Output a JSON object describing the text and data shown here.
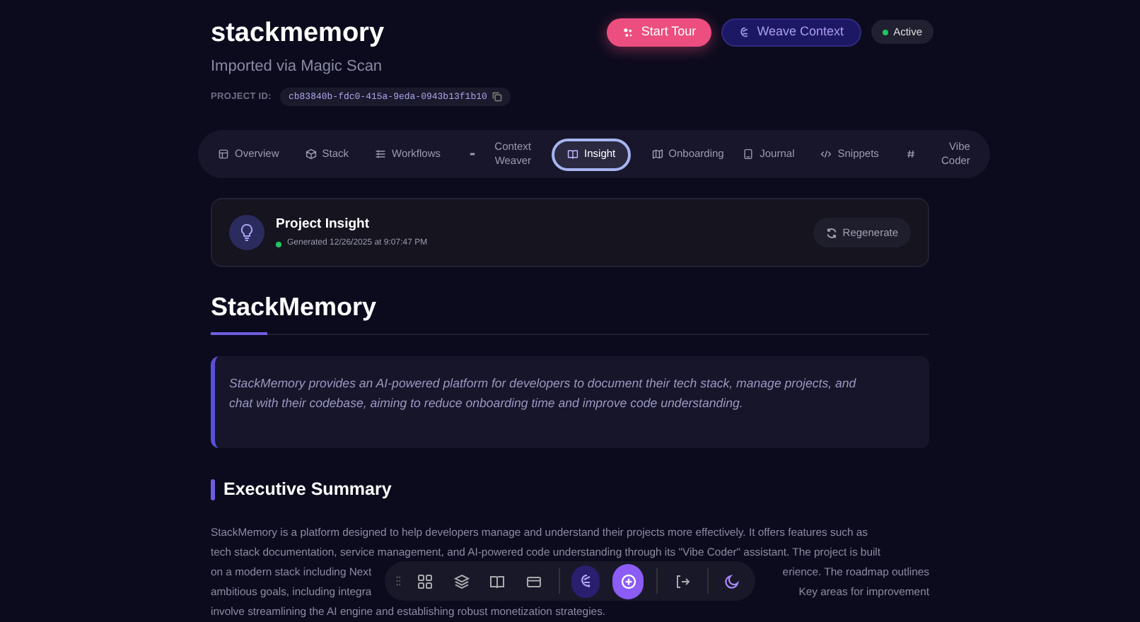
{
  "header": {
    "title": "stackmemory",
    "subtitle": "Imported via Magic Scan",
    "project_id_label": "PROJECT ID:",
    "project_id": "cb83840b-fdc0-415a-9eda-0943b13f1b10"
  },
  "actions": [
    {
      "label": "Start Tour",
      "kind": "primary"
    },
    {
      "label": "Weave Context",
      "kind": "secondary"
    }
  ],
  "status": {
    "label": "Active",
    "color": "#22c55e"
  },
  "tabs": [
    {
      "label": "Overview",
      "selected": false
    },
    {
      "label": "Stack",
      "selected": false
    },
    {
      "label": "Workflows",
      "selected": false
    },
    {
      "label": "Context Weaver",
      "selected": false
    },
    {
      "label": "Insight",
      "selected": true
    },
    {
      "label": "Onboarding",
      "selected": false
    },
    {
      "label": "Journal",
      "selected": false
    },
    {
      "label": "Snippets",
      "selected": false
    },
    {
      "label": "Vibe Coder",
      "selected": false
    }
  ],
  "insight": {
    "title": "Project Insight",
    "generated": "Generated 12/26/2025 at 9:07:47 PM",
    "regenerate": "Regenerate"
  },
  "heading": "StackMemory",
  "quote": "StackMemory provides an AI-powered platform for developers to document their tech stack, manage projects, and chat with their codebase, aiming to reduce onboarding time and improve code understanding.",
  "section_title": "Executive Summary",
  "summary_lines": [
    {
      "left": "StackMemory is a platform designed to help developers manage and understand their projects more effectively. It offers features such as"
    },
    {
      "left": "tech stack documentation, service management, and AI-powered code understanding through its \"Vibe Coder\" assistant. The project is built"
    },
    {
      "left": "on a modern stack including Next",
      "right": "erience. The roadmap outlines"
    },
    {
      "left": "ambitious goals, including integra",
      "right": "Key areas for improvement"
    },
    {
      "left": "involve streamlining the AI engine and establishing robust monetization strategies."
    }
  ]
}
